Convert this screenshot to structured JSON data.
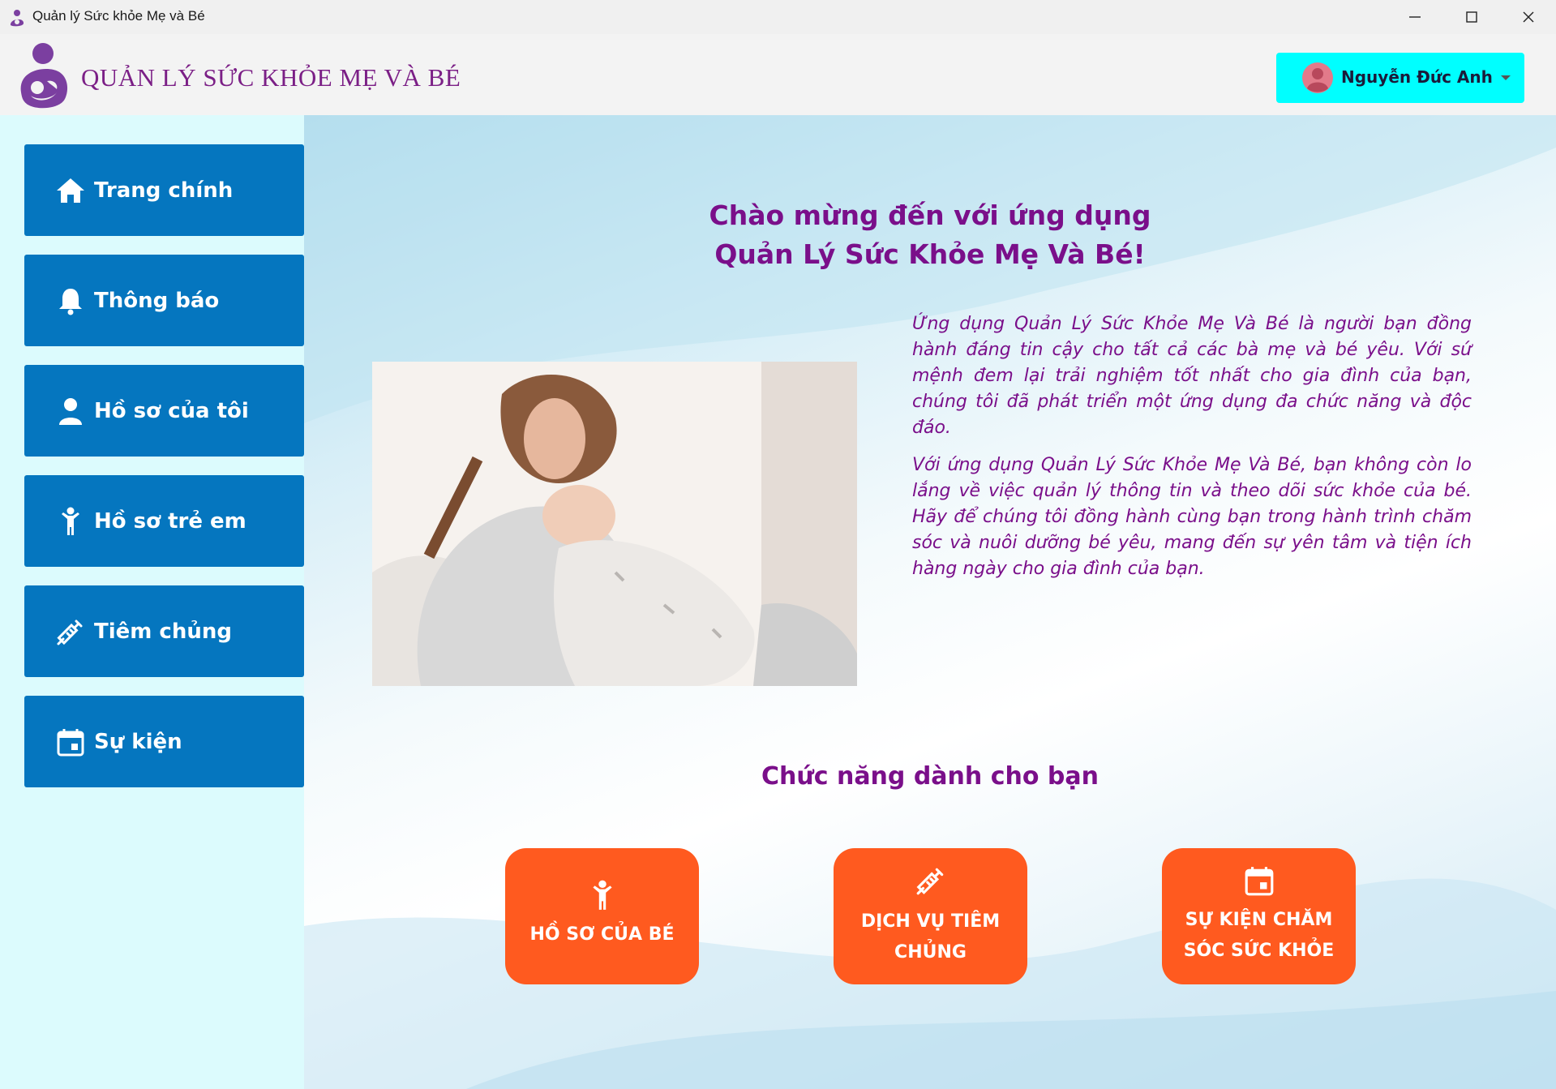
{
  "window": {
    "title": "Quản lý Sức khỏe Mẹ và Bé",
    "controls": [
      "minimize-icon",
      "maximize-icon",
      "close-icon"
    ]
  },
  "header": {
    "app_name": "QUẢN LÝ SỨC KHỎE MẸ VÀ BÉ",
    "user": {
      "name": "Nguyễn Đức Anh",
      "icon": "user-avatar-icon",
      "caret": "chevron-down-icon"
    }
  },
  "sidebar": {
    "items": [
      {
        "label": "Trang chính",
        "icon": "home-icon"
      },
      {
        "label": "Thông báo",
        "icon": "bell-icon"
      },
      {
        "label": "Hồ sơ của tôi",
        "icon": "user-icon"
      },
      {
        "label": "Hồ sơ trẻ em",
        "icon": "child-icon"
      },
      {
        "label": "Tiêm chủng",
        "icon": "syringe-icon"
      },
      {
        "label": "Sự kiện",
        "icon": "calendar-icon"
      }
    ]
  },
  "main": {
    "welcome_line1": "Chào mừng đến với ứng dụng",
    "welcome_line2": "Quản Lý Sức Khỏe Mẹ Và Bé!",
    "paragraph1": "Ứng dụng Quản Lý Sức Khỏe Mẹ Và Bé là người bạn đồng hành đáng tin cậy cho tất cả các bà mẹ và bé yêu. Với sứ mệnh đem lại trải nghiệm tốt nhất cho gia đình của bạn, chúng tôi đã phát triển một ứng dụng đa chức năng và độc đáo.",
    "paragraph2": "Với ứng dụng Quản Lý Sức Khỏe Mẹ Và Bé, bạn không còn lo lắng về việc quản lý thông tin và theo dõi sức khỏe của bé. Hãy để chúng tôi đồng hành cùng bạn trong hành trình chăm sóc và nuôi dưỡng bé yêu, mang đến sự yên tâm và tiện ích hàng ngày cho gia đình của bạn.",
    "functions_title": "Chức năng dành cho bạn",
    "cards": [
      {
        "line1": "HỒ SƠ CỦA BÉ",
        "line2": "",
        "icon": "child-icon"
      },
      {
        "line1": "DỊCH VỤ TIÊM",
        "line2": "CHỦNG",
        "icon": "syringe-icon"
      },
      {
        "line1": "SỰ KIỆN CHĂM",
        "line2": "SÓC SỨC KHỎE",
        "icon": "calendar-icon"
      }
    ]
  },
  "colors": {
    "nav_button": "#0576bf",
    "sidebar_bg": "#dcfbfd",
    "accent_purple": "#7a0f8a",
    "card_orange": "#ff5a1f",
    "user_button": "#00ffff"
  }
}
